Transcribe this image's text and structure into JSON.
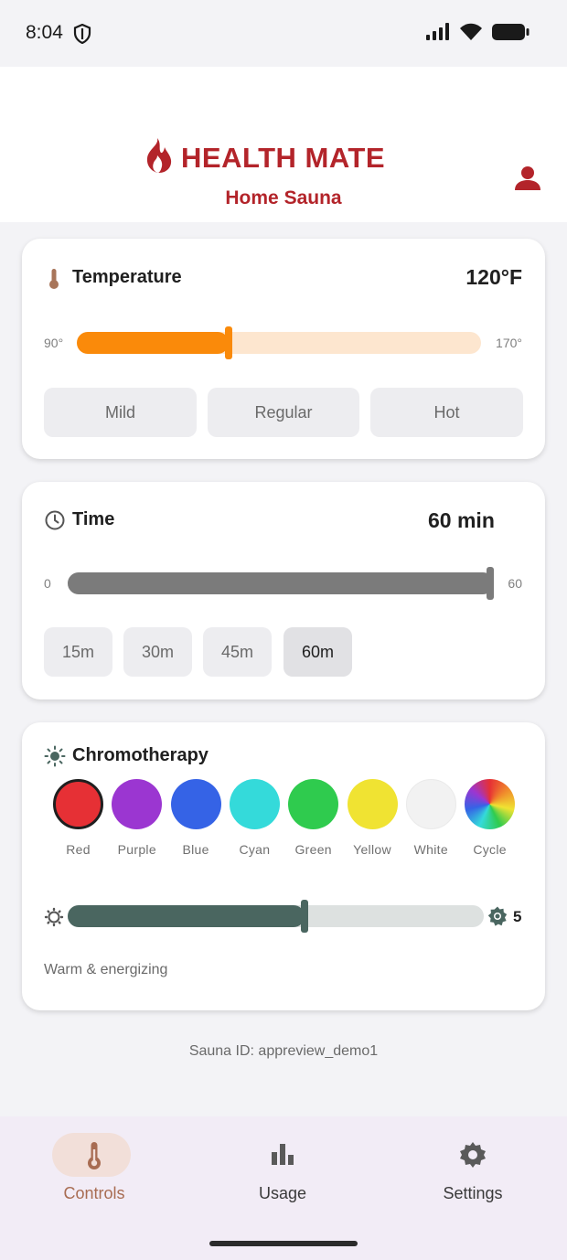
{
  "status_bar": {
    "time": "8:04"
  },
  "header": {
    "brand": "HEALTH MATE",
    "subtitle": "Home Sauna"
  },
  "temperature": {
    "title": "Temperature",
    "value": "120°F",
    "min_label": "90°",
    "max_label": "170°",
    "level": 0.375,
    "presets": [
      "Mild",
      "Regular",
      "Hot"
    ]
  },
  "time": {
    "title": "Time",
    "value": "60 min",
    "min_label": "0",
    "max_label": "60",
    "level": 1.0,
    "presets": [
      "15m",
      "30m",
      "45m",
      "60m"
    ],
    "selected": "60m"
  },
  "chromotherapy": {
    "title": "Chromotherapy",
    "colors": [
      {
        "label": "Red",
        "hex": "#e63035"
      },
      {
        "label": "Purple",
        "hex": "#9b36d1"
      },
      {
        "label": "Blue",
        "hex": "#3563e6"
      },
      {
        "label": "Cyan",
        "hex": "#34dada"
      },
      {
        "label": "Green",
        "hex": "#2fcb4e"
      },
      {
        "label": "Yellow",
        "hex": "#f0e332"
      },
      {
        "label": "White",
        "hex": "#f2f2f2"
      },
      {
        "label": "Cycle",
        "hex": "conic"
      }
    ],
    "selected": "Red",
    "brightness_value": "5",
    "brightness_level": 0.57,
    "description": "Warm & energizing"
  },
  "footer": {
    "sauna_id": "Sauna ID: appreview_demo1"
  },
  "nav": {
    "items": [
      {
        "label": "Controls",
        "icon": "thermometer-icon",
        "active": true
      },
      {
        "label": "Usage",
        "icon": "bar-chart-icon",
        "active": false
      },
      {
        "label": "Settings",
        "icon": "gear-icon",
        "active": false
      }
    ]
  },
  "colors": {
    "brand_red": "#b3242a",
    "temp_orange": "#fa8a0a",
    "temp_track": "#fde6cf",
    "time_gray": "#7b7b7b",
    "brightness_green": "#4a6660",
    "nav_active": "#a86c52"
  }
}
